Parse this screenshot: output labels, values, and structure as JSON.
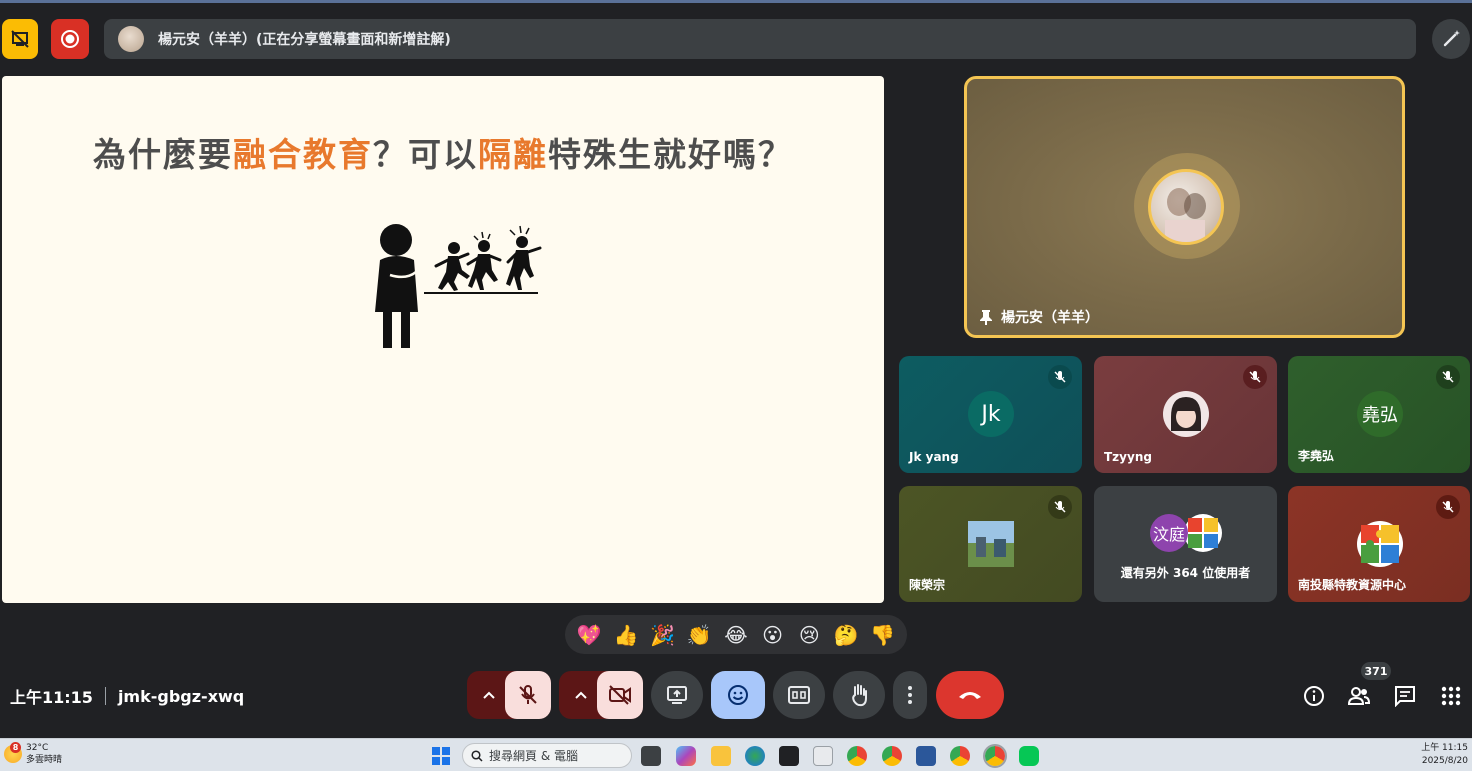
{
  "top_bar": {
    "presenter_banner": "楊元安（羊羊）(正在分享螢幕畫面和新增註解)"
  },
  "slide": {
    "title_parts": [
      {
        "text": "為什麼要",
        "highlight": false
      },
      {
        "text": "融合教育",
        "highlight": true
      },
      {
        "text": "？可以",
        "highlight": false
      },
      {
        "text": "隔離",
        "highlight": true
      },
      {
        "text": "特殊生就好嗎？",
        "highlight": false
      }
    ],
    "colors": {
      "text": "#4d4d4d",
      "highlight": "#e8792d",
      "background": "#fffbf0"
    }
  },
  "pinned": {
    "name": "楊元安（羊羊）",
    "icon": "pin-icon"
  },
  "participants": [
    {
      "id": "jk",
      "name": "Jk yang",
      "initials": "Jk",
      "avatar_color": "#0a6b64",
      "muted": true
    },
    {
      "id": "tzyyng",
      "name": "Tzyyng",
      "initials": "",
      "avatar_color": "#f1e6e6",
      "muted": true
    },
    {
      "id": "li",
      "name": "李堯弘",
      "initials": "堯弘",
      "avatar_color": "#2f6b2a",
      "muted": true
    },
    {
      "id": "chen",
      "name": "陳榮宗",
      "initials": "",
      "avatar_color": "#7aa3c2",
      "muted": true
    },
    {
      "id": "others",
      "name": "還有另外 364 位使用者",
      "initials": "汶庭",
      "avatar_color": "#8e44ad",
      "muted": false
    },
    {
      "id": "nantou",
      "name": "南投縣特教資源中心",
      "initials": "",
      "avatar_color": "#ffffff",
      "muted": true
    }
  ],
  "reactions": [
    "💖",
    "👍",
    "🎉",
    "👏",
    "😂",
    "😮",
    "😢",
    "🤔",
    "👎"
  ],
  "bottom_bar": {
    "time": "上午11:15",
    "meeting_code": "jmk-gbgz-xwq",
    "people_count": "371"
  },
  "taskbar": {
    "weather_temp": "32°C",
    "weather_desc": "多雲時晴",
    "weather_badge": "8",
    "search_placeholder": "搜尋網頁 & 電腦",
    "clock_time": "上午 11:15",
    "clock_date": "2025/8/20"
  }
}
